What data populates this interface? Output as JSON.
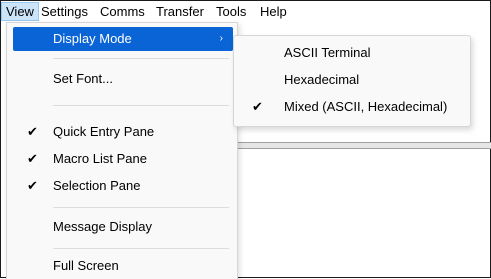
{
  "menubar": {
    "items": [
      {
        "label": "View"
      },
      {
        "label": "Settings"
      },
      {
        "label": "Comms"
      },
      {
        "label": "Transfer"
      },
      {
        "label": "Tools"
      },
      {
        "label": "Help"
      }
    ]
  },
  "view_menu": {
    "display_mode": "Display Mode",
    "submenu_arrow": "›",
    "set_font": "Set Font...",
    "quick_entry": "Quick Entry Pane",
    "macro_list": "Macro List Pane",
    "selection": "Selection Pane",
    "message_display": "Message Display",
    "full_screen": "Full Screen",
    "check_glyph": "✔"
  },
  "display_mode_submenu": {
    "ascii": "ASCII Terminal",
    "hex": "Hexadecimal",
    "mixed": "Mixed (ASCII, Hexadecimal)",
    "selected": "mixed"
  },
  "colors": {
    "highlight": "#0a64d6",
    "menubar_active": "#cce4f7"
  }
}
